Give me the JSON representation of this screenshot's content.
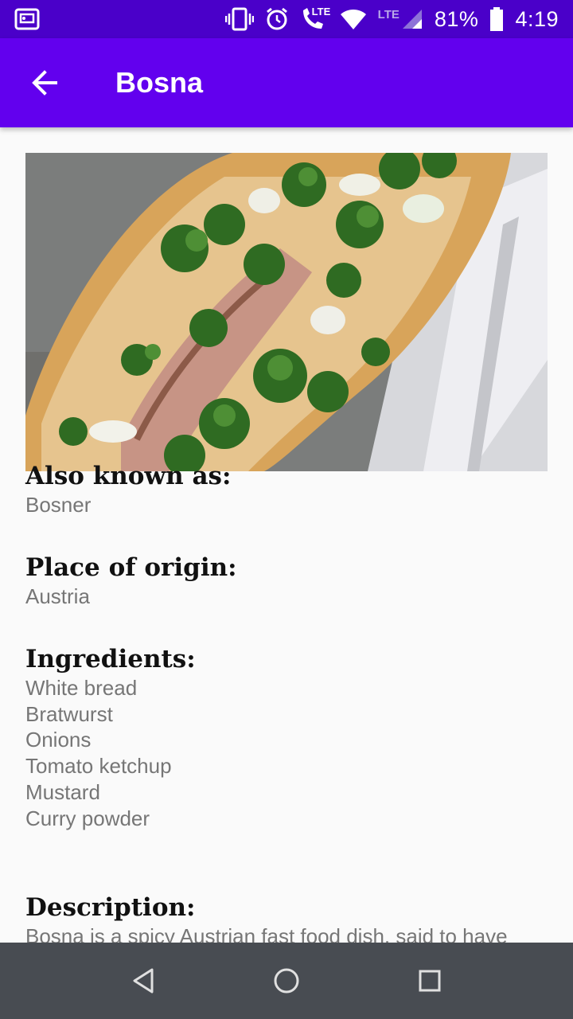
{
  "status_bar": {
    "network_label": "LTE",
    "network_label_2": "LTE",
    "battery": "81%",
    "time": "4:19"
  },
  "app_bar": {
    "title": "Bosna",
    "back_icon": "arrow-back-icon"
  },
  "dish": {
    "photo": "bosna-hotdog-photo",
    "sections": [
      {
        "heading": "Also known as:",
        "values": [
          "Bosner"
        ]
      },
      {
        "heading": "Place of origin:",
        "values": [
          "Austria"
        ]
      },
      {
        "heading": "Ingredients:",
        "values": [
          "White bread",
          "Bratwurst",
          "Onions",
          "Tomato ketchup",
          "Mustard",
          "Curry powder"
        ]
      },
      {
        "heading": "Description:",
        "values": [
          "Bosna is a spicy Austrian fast food dish, said to have"
        ]
      }
    ]
  },
  "nav_bar": {
    "back": "triangle-back-icon",
    "home": "circle-home-icon",
    "recents": "square-recents-icon"
  },
  "colors": {
    "status_bar": "#4a00c9",
    "app_bar": "#6200ee",
    "nav_bar": "#484c52"
  }
}
